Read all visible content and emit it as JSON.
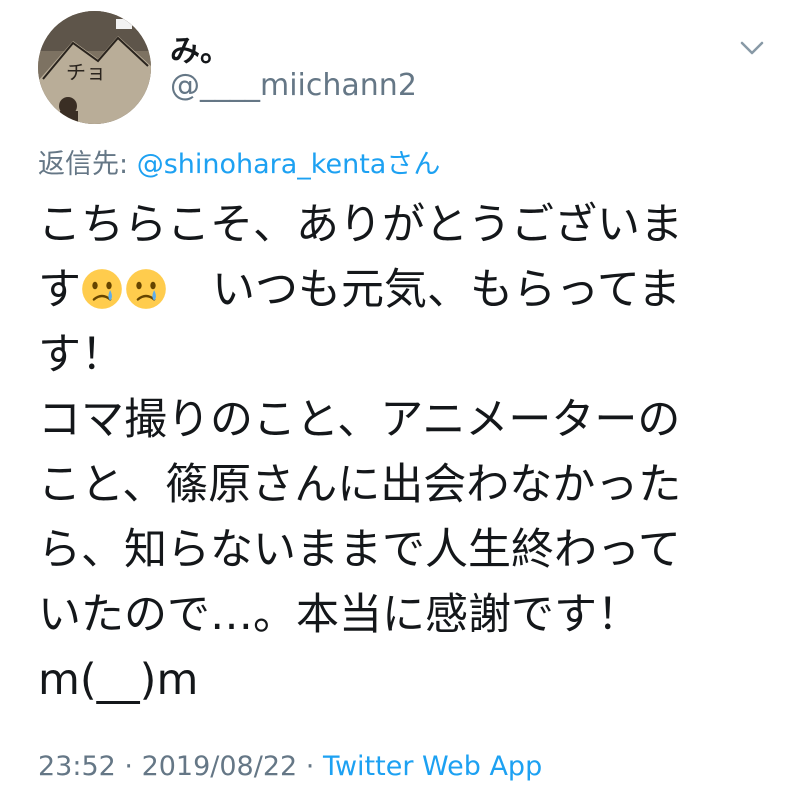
{
  "tweet": {
    "display_name": "み。",
    "handle": "@____miichann2",
    "reply_prefix": "返信先: ",
    "reply_mention": "@shinohara_kentaさん",
    "text_lines": [
      "こちらこそ、ありがとうございま",
      "す",
      "　いつも元気、もらってま",
      "す！",
      "コマ撮りのこと、アニメーターの",
      "こと、篠原さんに出会わなかった",
      "ら、知らないままで人生終わって",
      "いたので…。本当に感謝です！",
      "m(__)m"
    ],
    "emojis": [
      "crying-face",
      "crying-face"
    ],
    "time": "23:52",
    "date": "2019/08/22",
    "separator": " · ",
    "source": "Twitter Web App"
  },
  "colors": {
    "text": "#14171a",
    "secondary": "#657786",
    "link": "#1da1f2"
  },
  "icons": [
    "avatar",
    "chevron-down-icon",
    "crying-face-emoji"
  ]
}
